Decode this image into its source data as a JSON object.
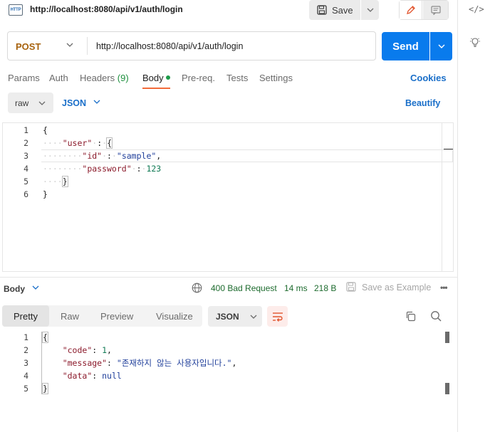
{
  "header": {
    "badge": "HTTP",
    "title": "http://localhost:8080/api/v1/auth/login",
    "save_label": "Save",
    "right_icon_code": "</>"
  },
  "request": {
    "method": "POST",
    "url": "http://localhost:8080/api/v1/auth/login",
    "send_label": "Send"
  },
  "tabs": {
    "params": "Params",
    "auth": "Auth",
    "headers": "Headers",
    "headers_count": "(9)",
    "body": "Body",
    "prereq": "Pre-req.",
    "tests": "Tests",
    "settings": "Settings",
    "cookies": "Cookies"
  },
  "body_options": {
    "mode": "raw",
    "language": "JSON",
    "beautify": "Beautify"
  },
  "request_body": {
    "line_numbers": [
      "1",
      "2",
      "3",
      "4",
      "5",
      "6"
    ]
  },
  "response": {
    "label": "Body",
    "status": "400 Bad Request",
    "time": "14 ms",
    "size": "218 B",
    "save_example": "Save as Example",
    "more": "•••",
    "view_tabs": {
      "pretty": "Pretty",
      "raw": "Raw",
      "preview": "Preview",
      "visualize": "Visualize"
    },
    "format": "JSON",
    "line_numbers": [
      "1",
      "2",
      "3",
      "4",
      "5"
    ],
    "code": 1,
    "message": "존재하지 않는 사용자입니다.",
    "data": "null"
  },
  "colors": {
    "send": "#097bed",
    "method": "#a7620d",
    "status": "#1d6b2e",
    "accent": "#f26b3a"
  }
}
